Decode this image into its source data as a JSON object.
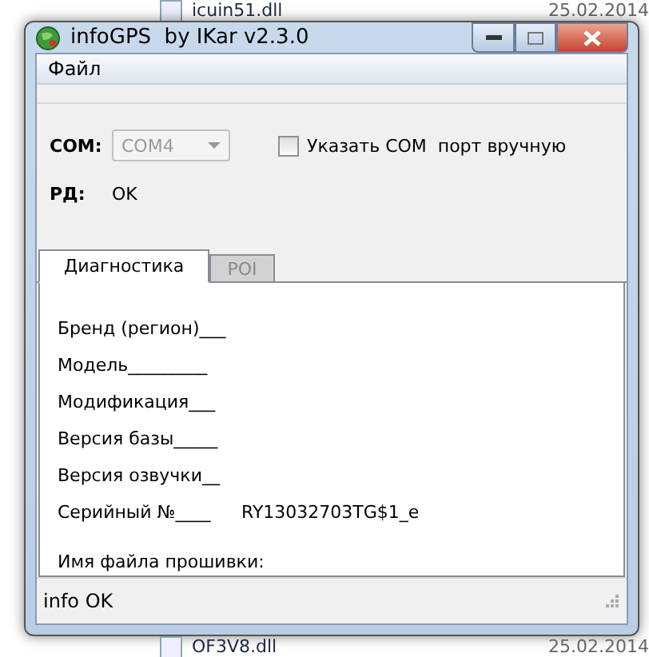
{
  "background_files": [
    {
      "name": "icuin51.dll",
      "date": "25.02.2014"
    },
    {
      "name": "OF3V8.dll",
      "date": "25.02.2014"
    }
  ],
  "window": {
    "title": "infoGPS  by IKar v2.3.0"
  },
  "menu": [
    {
      "label": "Файл"
    }
  ],
  "com": {
    "label": "COM:",
    "value": "COM4",
    "disabled": true
  },
  "manual_port": {
    "label": "Указать COM  порт вручную",
    "checked": false
  },
  "rd": {
    "label": "РД:",
    "value": "OK"
  },
  "tabs": [
    {
      "label": "Диагностика",
      "selected": true
    },
    {
      "label": "POI",
      "selected": false
    }
  ],
  "fields": [
    {
      "label": "Бренд (регион)___"
    },
    {
      "label": "Модель_________"
    },
    {
      "label": "Модификация___"
    },
    {
      "label": "Версия базы_____"
    },
    {
      "label": "Версия озвучки__"
    },
    {
      "label": "Серийный №____",
      "value": "RY13032703TG$1_e"
    }
  ],
  "firmware": {
    "label": "Имя файла прошивки:"
  },
  "status_bar": {
    "text": "info OK"
  }
}
